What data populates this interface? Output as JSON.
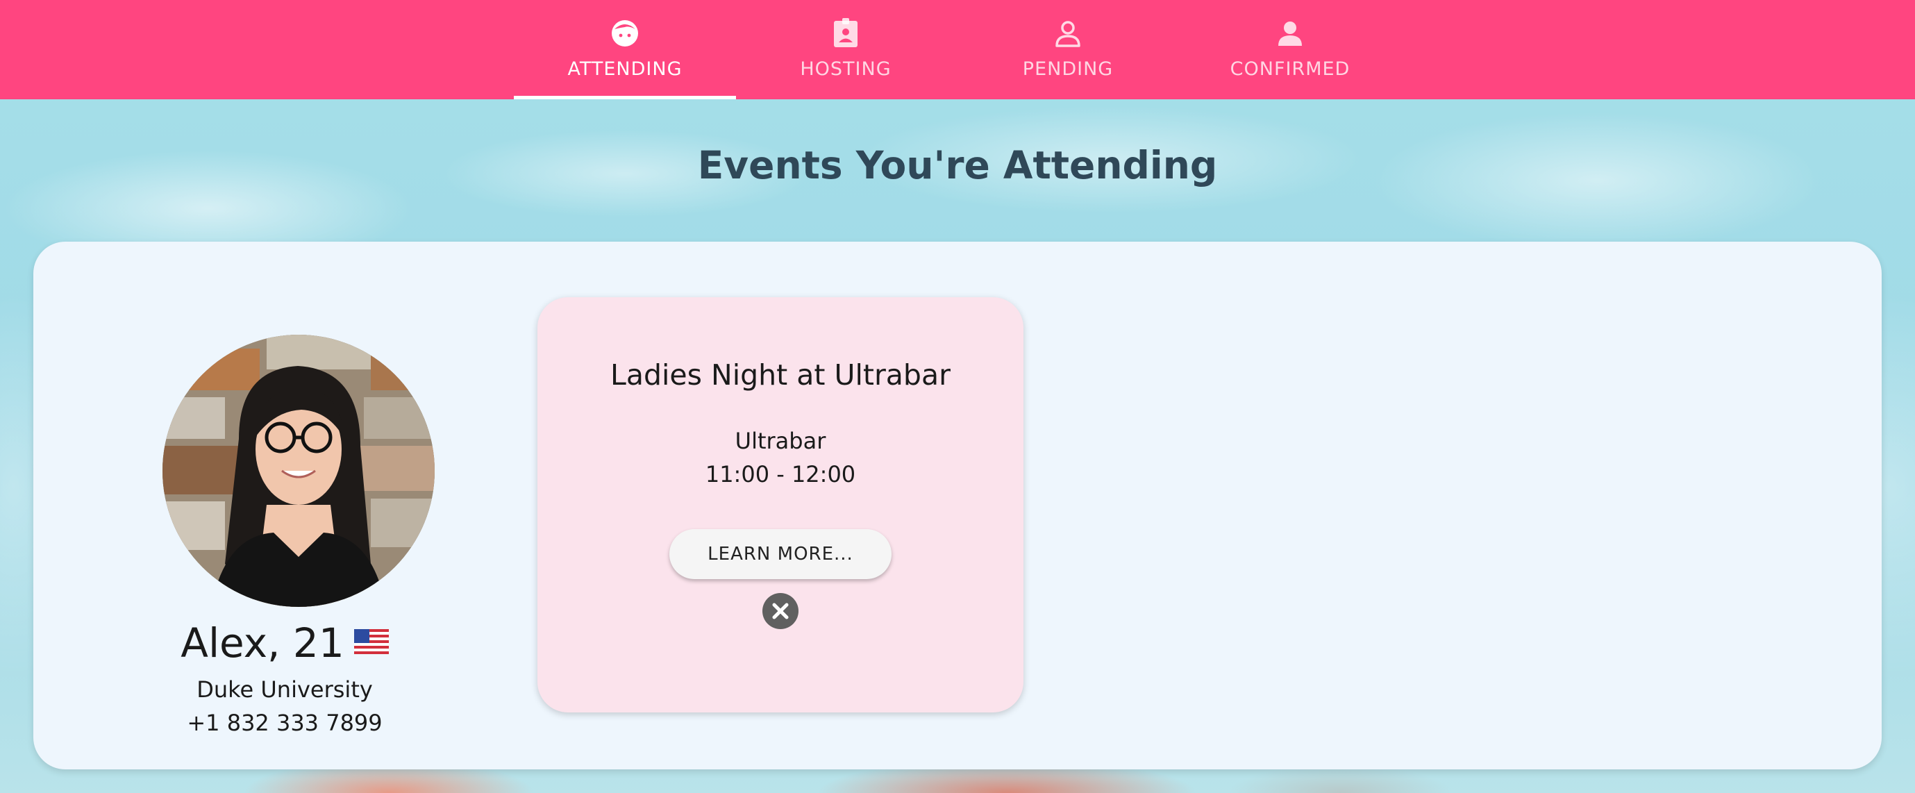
{
  "nav": {
    "tabs": [
      {
        "label": "ATTENDING",
        "icon": "face-icon",
        "active": true
      },
      {
        "label": "HOSTING",
        "icon": "badge-icon",
        "active": false
      },
      {
        "label": "PENDING",
        "icon": "person-outline-icon",
        "active": false
      },
      {
        "label": "CONFIRMED",
        "icon": "person-icon",
        "active": false
      }
    ]
  },
  "page": {
    "title": "Events You're Attending"
  },
  "profile": {
    "name": "Alex, 21",
    "flag": "us-flag-icon",
    "school": "Duke University",
    "phone": "+1 832 333 7899"
  },
  "event": {
    "title": "Ladies Night at Ultrabar",
    "venue": "Ultrabar",
    "time": "11:00 - 12:00",
    "learn_more_label": "LEARN MORE..."
  },
  "colors": {
    "nav_bg": "#ff4580",
    "panel_bg": "#eef6fd",
    "card_bg": "#fbe3ec",
    "title_text": "#2f4858"
  }
}
